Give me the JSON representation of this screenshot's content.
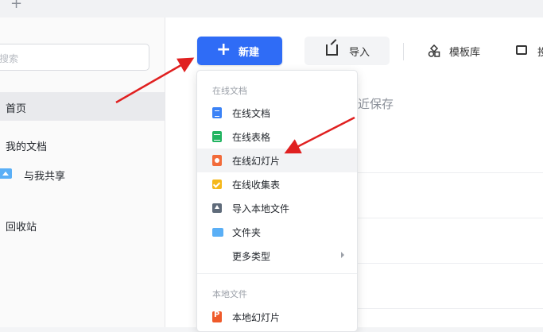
{
  "topbar": {
    "new_tab_glyph": "+"
  },
  "sidebar": {
    "search_placeholder": "搜索",
    "items": [
      {
        "label": "首页",
        "active": true
      },
      {
        "label": "我的文档"
      },
      {
        "label": "与我共享",
        "icon": "shared-folder-icon"
      },
      {
        "label": "回收站"
      }
    ]
  },
  "toolbar": {
    "new_glyph": "+",
    "new_label": "新建",
    "import_label": "导入",
    "template_label": "模板库",
    "fourth_label": "投"
  },
  "background": {
    "partial_text": "最近保存"
  },
  "menu": {
    "online_header": "在线文档",
    "online_items": [
      {
        "label": "在线文档",
        "icon": "doc-icon"
      },
      {
        "label": "在线表格",
        "icon": "sheet-icon"
      },
      {
        "label": "在线幻灯片",
        "icon": "slide-icon",
        "highlighted": true
      },
      {
        "label": "在线收集表",
        "icon": "form-icon"
      },
      {
        "label": "导入本地文件",
        "icon": "upload-icon"
      },
      {
        "label": "文件夹",
        "icon": "folder-icon"
      },
      {
        "label": "更多类型",
        "icon": "submenu-arrow-icon"
      }
    ],
    "local_header": "本地文件",
    "local_items": [
      {
        "label": "本地幻灯片",
        "icon": "ppt-icon"
      }
    ]
  },
  "colors": {
    "accent": "#2f6cf6",
    "annotation": "#e02020"
  }
}
